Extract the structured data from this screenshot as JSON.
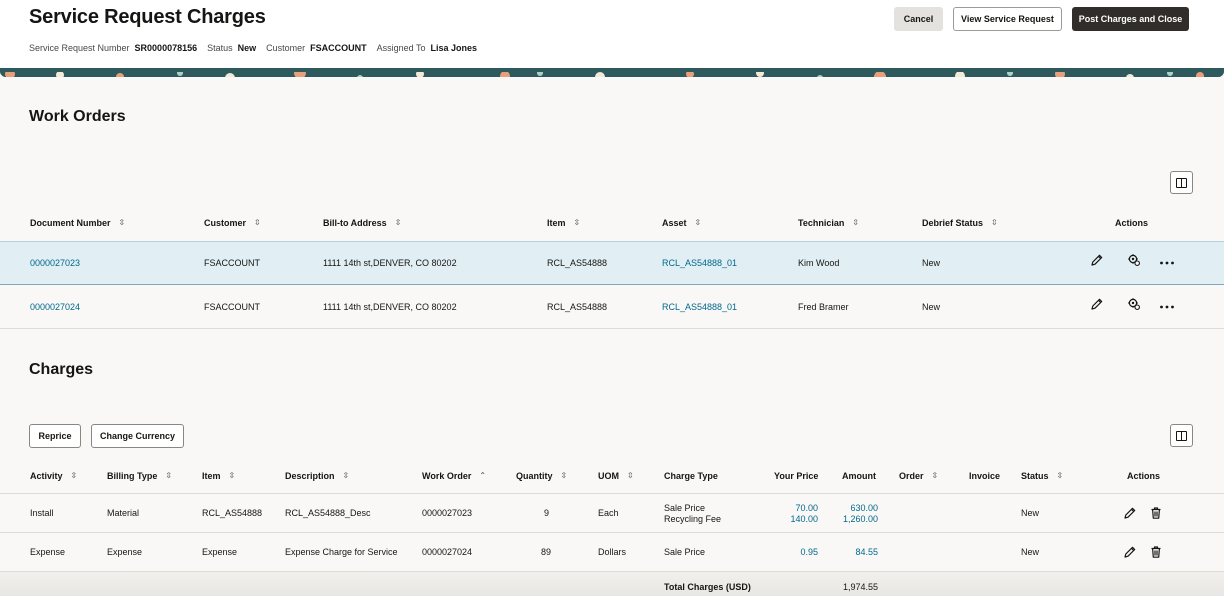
{
  "header": {
    "title": "Service Request Charges",
    "meta": [
      {
        "label": "Service Request Number",
        "value": "SR0000078156"
      },
      {
        "label": "Status",
        "value": "New"
      },
      {
        "label": "Customer",
        "value": "FSACCOUNT"
      },
      {
        "label": "Assigned To",
        "value": "Lisa Jones"
      }
    ],
    "buttons": {
      "cancel": "Cancel",
      "view": "View Service Request",
      "post": "Post Charges and Close"
    }
  },
  "work_orders": {
    "title": "Work Orders",
    "columns": [
      "Document Number",
      "Customer",
      "Bill-to Address",
      "Item",
      "Asset",
      "Technician",
      "Debrief Status",
      "Actions"
    ],
    "rows": [
      {
        "document": "0000027023",
        "customer": "FSACCOUNT",
        "address": "1111 14th st,DENVER, CO 80202",
        "item": "RCL_AS54888",
        "asset": "RCL_AS54888_01",
        "technician": "Kim Wood",
        "status": "New"
      },
      {
        "document": "0000027024",
        "customer": "FSACCOUNT",
        "address": "1111 14th st,DENVER, CO 80202",
        "item": "RCL_AS54888",
        "asset": "RCL_AS54888_01",
        "technician": "Fred Bramer",
        "status": "New"
      }
    ]
  },
  "charges": {
    "title": "Charges",
    "buttons": {
      "reprice": "Reprice",
      "currency": "Change Currency"
    },
    "columns": [
      "Activity",
      "Billing Type",
      "Item",
      "Description",
      "Work Order",
      "Quantity",
      "UOM",
      "Charge Type",
      "Your Price",
      "Amount",
      "Order",
      "Invoice",
      "Status",
      "Actions"
    ],
    "rows": [
      {
        "activity": "Install",
        "billing_type": "Material",
        "item": "RCL_AS54888",
        "description": "RCL_AS54888_Desc",
        "work_order": "0000027023",
        "quantity": "9",
        "uom": "Each",
        "charge_type_1": "Sale Price",
        "charge_type_2": "Recycling Fee",
        "price_1": "70.00",
        "price_2": "140.00",
        "amount_1": "630.00",
        "amount_2": "1,260.00",
        "status": "New"
      },
      {
        "activity": "Expense",
        "billing_type": "Expense",
        "item": "Expense",
        "description": "Expense Charge for Service",
        "work_order": "0000027024",
        "quantity": "89",
        "uom": "Dollars",
        "charge_type_1": "Sale Price",
        "price_1": "0.95",
        "amount_1": "84.55",
        "status": "New"
      }
    ],
    "total_label": "Total Charges (USD)",
    "total_value": "1,974.55"
  },
  "icons": {
    "sort": "sort-arrows-icon",
    "sort_asc": "sort-ascending-icon",
    "edit": "pencil-icon",
    "debrief": "gears-icon",
    "more": "ellipsis-icon",
    "delete": "trash-icon",
    "columns": "column-layout-icon"
  },
  "colors": {
    "link": "#00688c",
    "primary_button": "#312d2a",
    "selected_row": "#e1eef3",
    "banner": "#2e5a5e"
  }
}
